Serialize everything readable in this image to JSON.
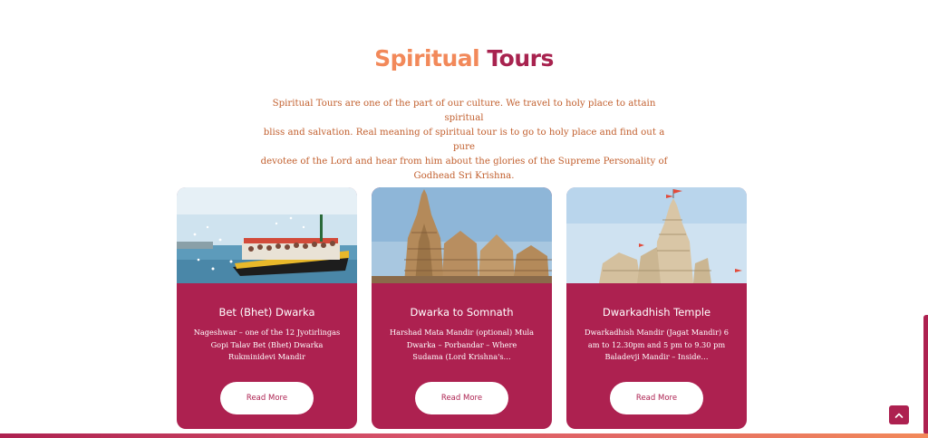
{
  "section": {
    "title_part1": "Spiritual",
    "title_part2": "Tours",
    "intro_line1": "Spiritual Tours are one of the part of our culture. We travel to holy place to attain spiritual",
    "intro_line2": "bliss and salvation. Real meaning of spiritual tour is to go to holy place and find out a pure",
    "intro_line3": "devotee of the Lord and hear from him about the glories of the Supreme Personality of",
    "intro_line4": "Godhead Sri Krishna."
  },
  "cards": [
    {
      "title": "Bet (Bhet) Dwarka",
      "desc_line1": "Nageshwar – one of the 12 Jyotirlingas",
      "desc_line2": "Gopi Talav Bet (Bhet) Dwarka",
      "desc_line3": "Rukminidevi Mandir",
      "button": "Read More"
    },
    {
      "title": "Dwarka to Somnath",
      "desc_line1": "Harshad Mata Mandir (optional) Mula",
      "desc_line2": "Dwarka – Porbandar – Where",
      "desc_line3": "Sudama (Lord Krishna's…",
      "button": "Read More"
    },
    {
      "title": "Dwarkadhish Temple",
      "desc_line1": "Dwarkadhish Mandir (Jagat Mandir) 6",
      "desc_line2": "am to 12.30pm and 5 pm to 9.30 pm",
      "desc_line3": "Baladevji Mandir – Inside…",
      "button": "Read More"
    }
  ],
  "colors": {
    "accent_orange": "#f2895a",
    "accent_crimson": "#ad2150",
    "intro_text": "#c2602f"
  },
  "icons": {
    "scroll_top": "chevron-up-icon"
  }
}
